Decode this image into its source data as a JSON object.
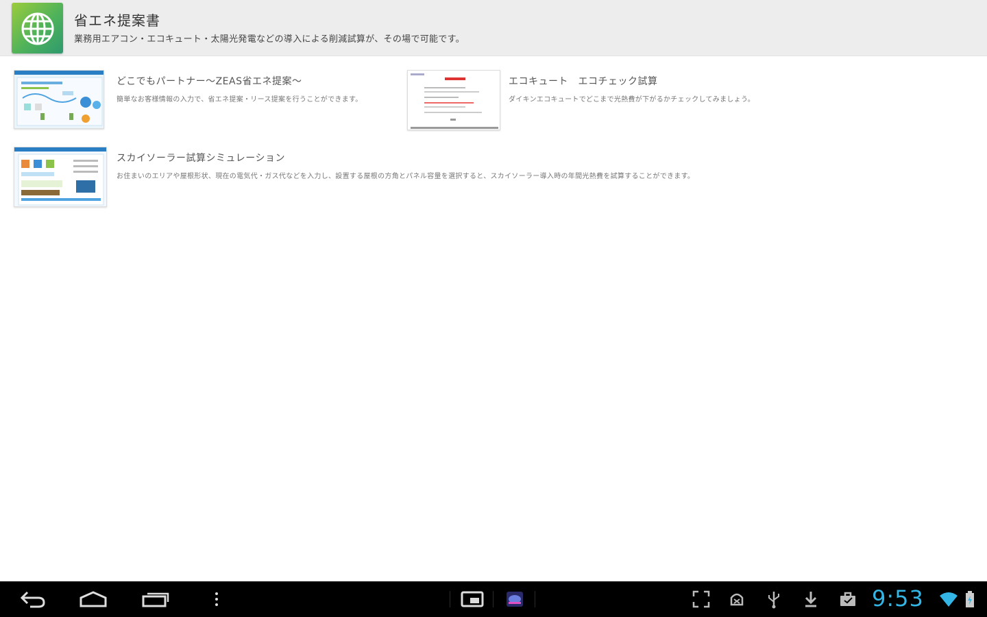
{
  "header": {
    "icon": "globe-icon",
    "title": "省エネ提案書",
    "description": "業務用エアコン・エコキュート・太陽光発電などの導入による削減試算が、その場で可能です。"
  },
  "items": [
    {
      "title": "どこでもパートナー～ZEAS省エネ提案～",
      "description": "簡単なお客様情報の入力で、省エネ提案・リース提案を行うことができます。"
    },
    {
      "title": "エコキュート　エコチェック試算",
      "description": "ダイキンエコキュートでどこまで光熱費が下がるかチェックしてみましょう。"
    },
    {
      "title": "スカイソーラー試算シミュレーション",
      "description": "お住まいのエリアや屋根形状、現在の電気代・ガス代などを入力し、設置する屋根の方角とパネル容量を選択すると、スカイソーラー導入時の年間光熱費を試算することができます。"
    }
  ],
  "statusbar": {
    "time": "9:53",
    "icons": [
      "back-icon",
      "home-icon",
      "recent-apps-icon",
      "menu-icon",
      "screenshot-icon",
      "app-notification-icon",
      "fullscreen-icon",
      "android-debug-icon",
      "usb-icon",
      "download-icon",
      "briefcase-icon",
      "wifi-icon",
      "battery-icon"
    ]
  },
  "colors": {
    "accent": "#33b5e5",
    "header_bg": "#ededed",
    "icon_green": "#4fb25a"
  }
}
